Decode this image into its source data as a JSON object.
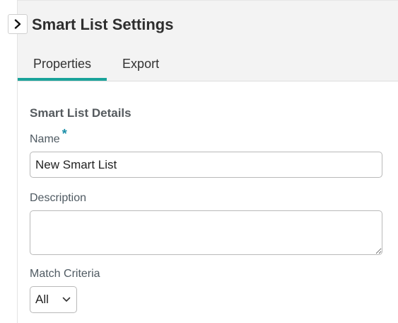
{
  "header": {
    "title": "Smart List Settings",
    "collapse_icon": "chevron-right-icon"
  },
  "tabs": [
    {
      "label": "Properties",
      "active": true
    },
    {
      "label": "Export",
      "active": false
    }
  ],
  "form": {
    "section_title": "Smart List Details",
    "name_label": "Name",
    "required_marker": "*",
    "name_value": "New Smart List",
    "description_label": "Description",
    "description_value": "",
    "match_label": "Match Criteria",
    "match_value": "All"
  },
  "colors": {
    "accent": "#1aa39a",
    "required": "#1a8fa8",
    "header_bg": "#f3f3f3"
  }
}
